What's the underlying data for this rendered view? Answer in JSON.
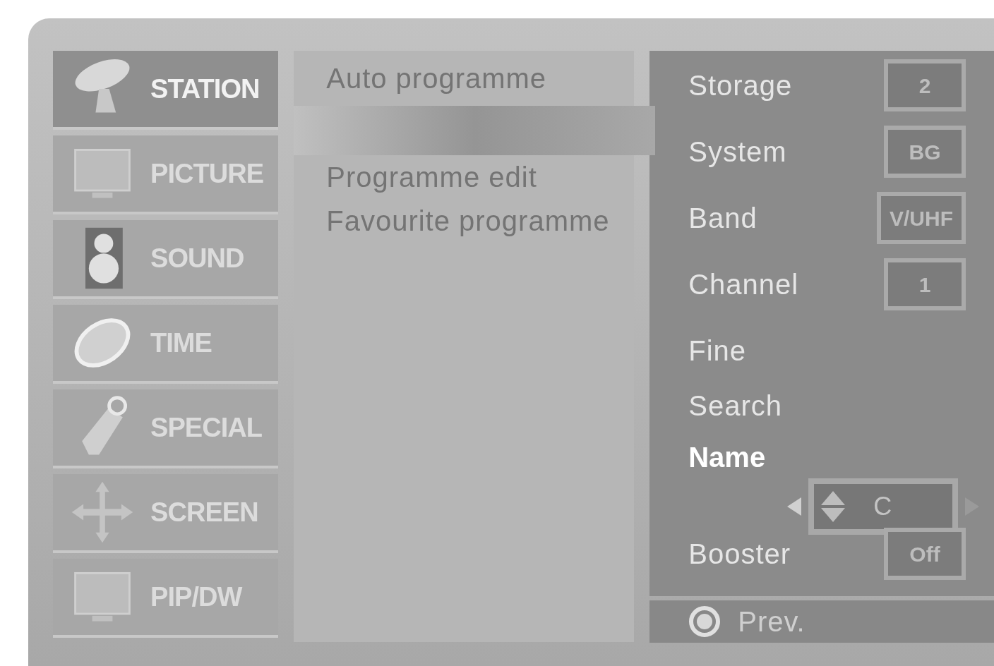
{
  "menu": [
    {
      "label": "STATION",
      "selected": true
    },
    {
      "label": "PICTURE",
      "selected": false
    },
    {
      "label": "SOUND",
      "selected": false
    },
    {
      "label": "TIME",
      "selected": false
    },
    {
      "label": "SPECIAL",
      "selected": false
    },
    {
      "label": "SCREEN",
      "selected": false
    },
    {
      "label": "PIP/DW",
      "selected": false
    }
  ],
  "submenu": [
    {
      "label": "Auto programme",
      "selected": false
    },
    {
      "selected": true
    },
    {
      "label": "Programme edit",
      "selected": false
    },
    {
      "label": "Favourite programme",
      "selected": false
    }
  ],
  "settings": [
    {
      "kind": "box",
      "label": "Storage",
      "value": "2",
      "selected": false
    },
    {
      "kind": "box",
      "label": "System",
      "value": "BG",
      "selected": false
    },
    {
      "kind": "box",
      "label": "Band",
      "value": "V/UHF",
      "selected": false
    },
    {
      "kind": "box",
      "label": "Channel",
      "value": "1",
      "selected": false
    },
    {
      "kind": "plain",
      "label": "Fine",
      "selected": false
    },
    {
      "kind": "plain",
      "label": "Search",
      "selected": false
    },
    {
      "kind": "stepper",
      "label": "Name",
      "value": "C",
      "selected": true
    },
    {
      "kind": "box",
      "label": "Booster",
      "value": "Off",
      "selected": false
    }
  ],
  "footer": {
    "label": "Prev."
  }
}
